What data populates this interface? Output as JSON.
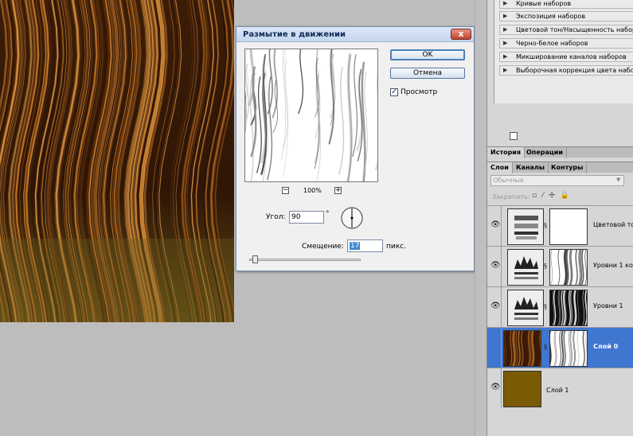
{
  "dialog": {
    "title": "Размытие в движении",
    "ok_label": "OK",
    "cancel_label": "Отмена",
    "preview_label": "Просмотр",
    "preview_checked": true,
    "zoom_out": "−",
    "zoom_level": "100%",
    "zoom_in": "+",
    "angle_label": "Угол:",
    "angle_value": "90",
    "degree_sign": "°",
    "offset_label": "Смещение:",
    "offset_value": "17",
    "offset_unit": "пикс.",
    "close_label": "x"
  },
  "adjustments": {
    "items": [
      {
        "label": "Кривые наборов"
      },
      {
        "label": "Экспозиция наборов"
      },
      {
        "label": "Цветовой тон/Насыщенность наборов"
      },
      {
        "label": "Черно-белое наборов"
      },
      {
        "label": "Микширование каналов наборов"
      },
      {
        "label": "Выборочная коррекция цвета наборов"
      }
    ]
  },
  "panel_tabs_top": [
    {
      "label": "История",
      "active": true
    },
    {
      "label": "Операции",
      "active": false
    }
  ],
  "panel_tabs_layers": [
    {
      "label": "Слои",
      "active": true
    },
    {
      "label": "Каналы",
      "active": false
    },
    {
      "label": "Контуры",
      "active": false
    }
  ],
  "layers_panel": {
    "blend_mode": "Обычные",
    "lock_label": "Закрепить:",
    "lock_icons": "▫ ⁄ ✢ 🔒"
  },
  "layers": [
    {
      "name": "Цветовой то",
      "thumb": "hue-adjustment-icon",
      "selected": false
    },
    {
      "name": "Уровни 1 ко",
      "thumb": "levels-adjustment-icon",
      "selected": false
    },
    {
      "name": "Уровни 1",
      "thumb": "levels-adjustment-icon",
      "selected": false
    },
    {
      "name": "Слой 0",
      "thumb": "hair-texture",
      "selected": true
    },
    {
      "name": "Слой 1",
      "thumb": "brown-fill",
      "selected": false
    }
  ],
  "colors": {
    "hair_dark": "#2a1205",
    "hair_light": "#c57a2b",
    "hair_olive": "#6b5a1c",
    "layer1_fill": "#7a5a05",
    "selection": "#3f76cf"
  }
}
